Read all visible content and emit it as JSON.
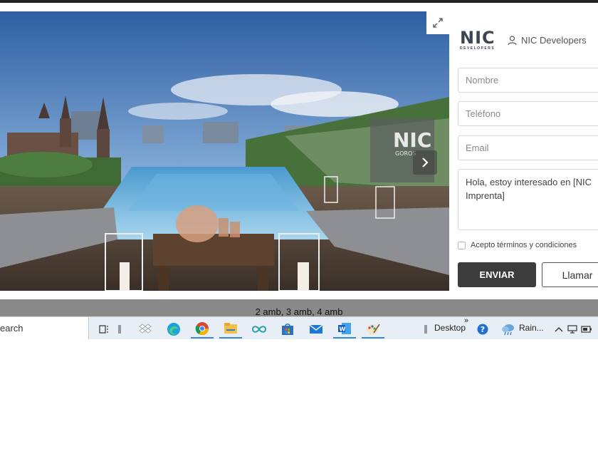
{
  "gallery": {
    "image_alt": "Rooftop pool terrace render",
    "sign_text": "NIC",
    "sign_sub": "GOROS"
  },
  "brand": {
    "logo": "NIC",
    "logo_sub": "DEVELOPERS",
    "user_label": "NIC Developers"
  },
  "form": {
    "name_placeholder": "Nombre",
    "phone_placeholder": "Teléfono",
    "email_placeholder": "Email",
    "message_value": "Hola, estoy interesado en [NIC Imprenta]",
    "terms_prefix": "Acepto ",
    "terms_link": "términos y condiciones",
    "send_label": "ENVIAR",
    "call_label": "Llamar"
  },
  "caption": "2 amb, 3 amb, 4 amb",
  "taskbar": {
    "search_text": "earch",
    "desktop_label": "Desktop",
    "overflow_label": "»",
    "weather_label": "Rain...",
    "apps": [
      "task-view",
      "dropbox",
      "edge",
      "chrome",
      "file-explorer",
      "infinity-app",
      "store",
      "mail",
      "word",
      "paint"
    ]
  },
  "colors": {
    "primary_button": "#3c3c3c",
    "brand_text": "#3b4652",
    "caption_bar": "#8a8a8a",
    "taskbar": "#e8eef6"
  }
}
